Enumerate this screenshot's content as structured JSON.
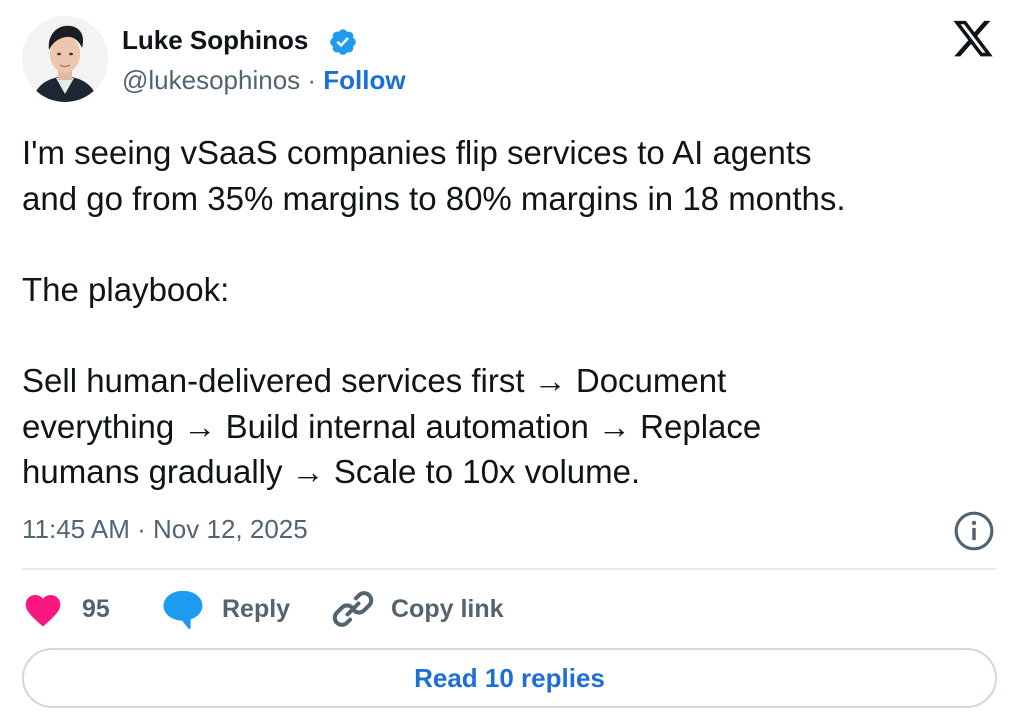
{
  "author": {
    "name": "Luke Sophinos",
    "handle": "@lukesophinos",
    "separator": " · ",
    "follow_label": "Follow",
    "verified": true
  },
  "tweet": {
    "lines": [
      "I'm seeing vSaaS companies flip services to AI agents",
      "and go from 35% margins to 80% margins in 18 months.",
      "",
      "The playbook:",
      "",
      "Sell human-delivered services first → Document",
      "everything → Build internal automation → Replace",
      "humans gradually → Scale to 10x volume."
    ],
    "timestamp": "11:45 AM · Nov 12, 2025"
  },
  "actions": {
    "like_count": "95",
    "reply_label": "Reply",
    "copy_link_label": "Copy link"
  },
  "read_replies_label": "Read 10 replies",
  "icons": {
    "brand": "x-logo-icon",
    "verified": "verified-badge-icon",
    "info": "info-icon",
    "like": "heart-icon",
    "reply": "speech-bubble-icon",
    "copy": "link-icon"
  },
  "colors": {
    "text_primary": "#0f1419",
    "text_secondary": "#536471",
    "link_blue": "#1d6fd8",
    "verified_blue": "#1d9bf0",
    "heart_pink": "#f91880",
    "divider": "#e7e9ea"
  }
}
